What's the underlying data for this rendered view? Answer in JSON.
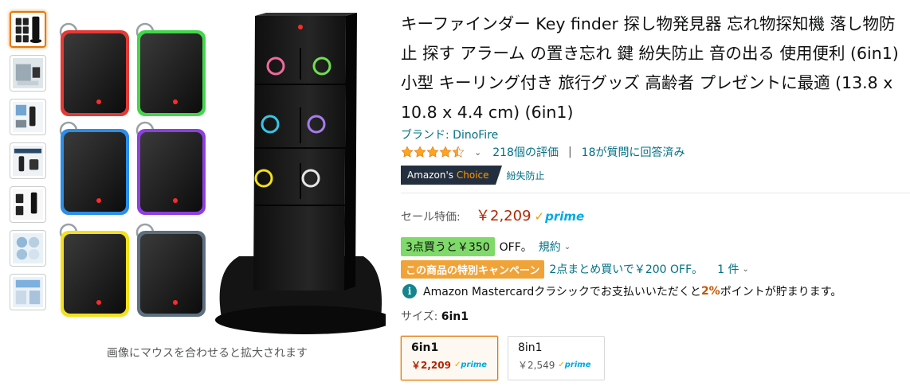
{
  "gallery": {
    "thumbnails": [
      "thumb-1",
      "thumb-2",
      "thumb-3",
      "thumb-4",
      "thumb-5",
      "thumb-6",
      "thumb-7"
    ],
    "hover_hint": "画像にマウスを合わせると拡大されます"
  },
  "product": {
    "title_lines": [
      "キーファインダー Key finder 探し物発見器 忘れ物探知機 落し物防",
      "止 探す アラーム の置き忘れ 鍵 紛失防止 音の出る 使用便利 (6in1)",
      "小型 キーリング付き 旅行グッズ 高齢者 プレゼントに最適 (13.8 x",
      "10.8 x 4.4 cm) (6in1)"
    ],
    "brand": "ブランド: DinoFire",
    "rating": 4.5,
    "ratings_count": "218個の評価",
    "separator": "|",
    "answered": "18が質問に回答済み",
    "choice": {
      "prefix": "Amazon's ",
      "word": "Choice",
      "keyword": "紛失防止"
    }
  },
  "pricing": {
    "label": "セール特価:",
    "price": "￥2,209",
    "prime_check": "✓",
    "prime_word": "prime"
  },
  "offers": {
    "bulk_badge": "3点買うと￥350",
    "bulk_text": "OFF。",
    "bulk_link": "規約",
    "promo_badge": "この商品の特別キャンペーン",
    "promo_text": "2点まとめ買いで￥200 OFF。",
    "promo_qty": "1 件",
    "mastercard_before": "Amazon Mastercardクラシックでお支払いいただくと",
    "mastercard_pct": "2%",
    "mastercard_after": "ポイントが貯まります。"
  },
  "size": {
    "label": "サイズ:",
    "selected": "6in1",
    "options": [
      {
        "name": "6in1",
        "price": "￥2,209",
        "prime": "prime"
      },
      {
        "name": "8in1",
        "price": "￥2,549",
        "prime": "prime"
      }
    ]
  },
  "colors": {
    "accent": "#e77600",
    "link": "#007185",
    "price": "#b12704",
    "prime": "#00a8e1",
    "star": "#ffa41c",
    "tracker_borders": [
      "#e53935",
      "#43d64b",
      "#2b8ee8",
      "#8e3fe0",
      "#f2e11c",
      "#5d6f80"
    ],
    "remote_buttons": [
      "#f06b9c",
      "#6fe04f",
      "#37c6e6",
      "#a67cf0",
      "#f2e11c",
      "#e6e6e6"
    ]
  },
  "icons": {
    "info": "info-icon",
    "star": "star-icon",
    "chevron": "chevron-down-icon"
  }
}
